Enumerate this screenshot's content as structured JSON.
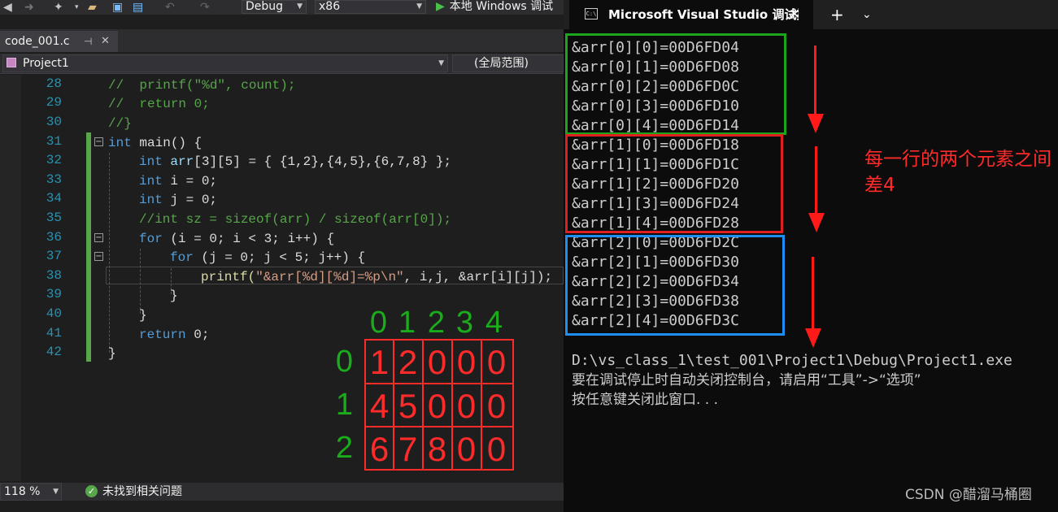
{
  "toolbar": {
    "config": "Debug",
    "platform": "x86",
    "run_label": "本地 Windows 调试"
  },
  "tab": {
    "filename": "code_001.c",
    "pin": "⊣",
    "close": "✕"
  },
  "navbar": {
    "project": "Project1",
    "scope": "(全局范围)"
  },
  "code": {
    "line_numbers": [
      "28",
      "29",
      "30",
      "31",
      "32",
      "33",
      "34",
      "35",
      "36",
      "37",
      "38",
      "39",
      "40",
      "41",
      "42"
    ],
    "l28": "//  printf(\"%d\", count);",
    "l29": "//  return 0;",
    "l30": "//}",
    "l31_kw": "int",
    "l31_rest": " main() {",
    "l32_kw": "int",
    "l32_var": "arr",
    "l32_rest": "[3][5] = { {1,2},{4,5},{6,7,8} };",
    "l33_kw": "int",
    "l33_rest": " i = 0;",
    "l34_kw": "int",
    "l34_rest": " j = 0;",
    "l35": "//int sz = sizeof(arr) / sizeof(arr[0]);",
    "l36_kw": "for",
    "l36_rest": " (i = 0; i < 3; i++) {",
    "l37_kw": "for",
    "l37_rest": " (j = 0; j < 5; j++) {",
    "l38_fn": "printf(",
    "l38_str": "\"&arr[%d][%d]=%p\\n\"",
    "l38_rest": ", i,j, &arr[i][j]);",
    "l39": "}",
    "l40": "}",
    "l41_kw": "return",
    "l41_rest": " 0;",
    "l42": "}"
  },
  "status": {
    "zoom": "118 %",
    "message": "未找到相关问题"
  },
  "overlay": {
    "col_headers": [
      "0",
      "1",
      "2",
      "3",
      "4"
    ],
    "row_headers": [
      "0",
      "1",
      "2"
    ],
    "rows": [
      [
        "1",
        "2",
        "0",
        "0",
        "0"
      ],
      [
        "4",
        "5",
        "0",
        "0",
        "0"
      ],
      [
        "6",
        "7",
        "8",
        "0",
        "0"
      ]
    ],
    "green": "#1aac1a",
    "red": "#ff2a2a"
  },
  "console": {
    "title": "Microsoft Visual Studio 调试控制台",
    "close": "✕",
    "new_tab": "+",
    "dropdown": "⌄",
    "icon": "C:\\",
    "lines": [
      "&arr[0][0]=00D6FD04",
      "&arr[0][1]=00D6FD08",
      "&arr[0][2]=00D6FD0C",
      "&arr[0][3]=00D6FD10",
      "&arr[0][4]=00D6FD14",
      "&arr[1][0]=00D6FD18",
      "&arr[1][1]=00D6FD1C",
      "&arr[1][2]=00D6FD20",
      "&arr[1][3]=00D6FD24",
      "&arr[1][4]=00D6FD28",
      "&arr[2][0]=00D6FD2C",
      "&arr[2][1]=00D6FD30",
      "&arr[2][2]=00D6FD34",
      "&arr[2][3]=00D6FD38",
      "&arr[2][4]=00D6FD3C"
    ],
    "exit_line": "D:\\vs_class_1\\test_001\\Project1\\Debug\\Project1.exe",
    "hint_line": "要在调试停止时自动关闭控制台，请启用“工具”->“选项”",
    "press_line": "按任意键关闭此窗口. . .",
    "box_colors": [
      "#1aa51a",
      "#e02020",
      "#1e8ef0"
    ],
    "annotation": "每一行的两个元素之间差4",
    "watermark": "CSDN @醋溜马桶圈"
  }
}
